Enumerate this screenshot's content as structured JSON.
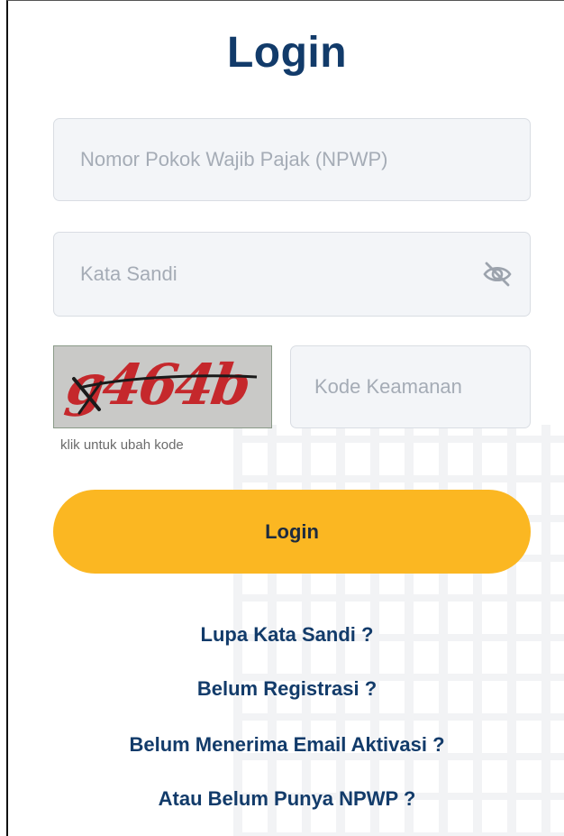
{
  "title": "Login",
  "npwp_field": {
    "placeholder": "Nomor Pokok Wajib Pajak (NPWP)",
    "value": ""
  },
  "password_field": {
    "placeholder": "Kata Sandi",
    "value": "",
    "toggle_icon": "eye-slash-icon"
  },
  "captcha": {
    "code": "g464b",
    "hint": "klik untuk ubah kode"
  },
  "security_code_field": {
    "placeholder": "Kode Keamanan",
    "value": ""
  },
  "login_button": {
    "label": "Login"
  },
  "links": [
    "Lupa Kata Sandi ?",
    "Belum Registrasi ?",
    "Belum Menerima Email Aktivasi ?",
    "Atau Belum Punya NPWP ?"
  ],
  "colors": {
    "heading": "#123b6a",
    "button": "#fbb722",
    "field_bg": "#f3f5f8",
    "captcha_text": "#c5282c"
  }
}
